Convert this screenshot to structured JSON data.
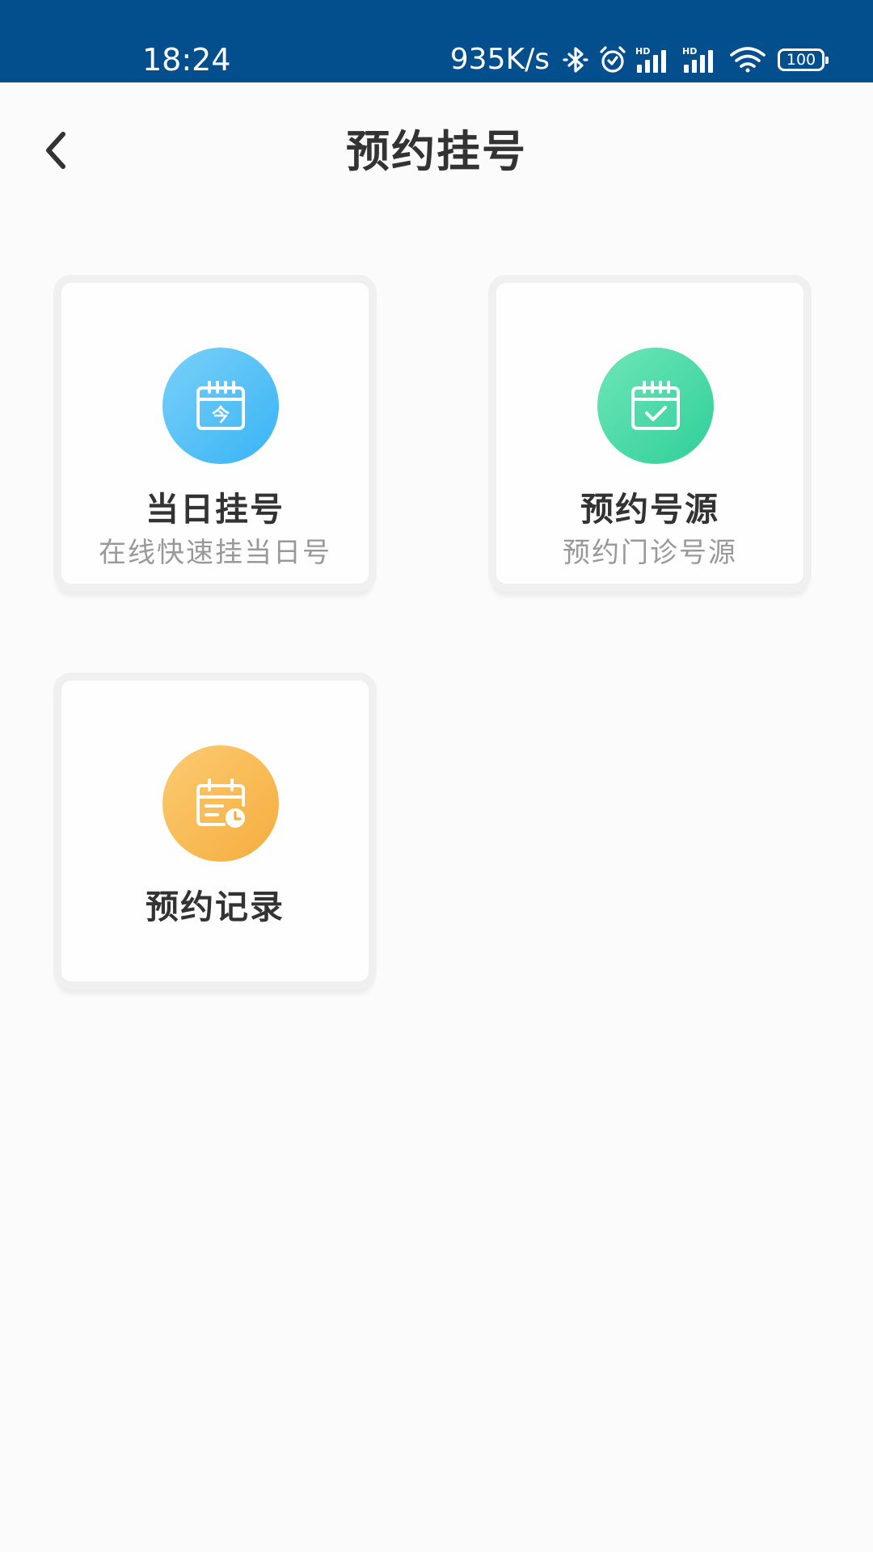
{
  "status_bar": {
    "time": "18:24",
    "net_speed": "935K/s",
    "battery": "100",
    "background": "#034f8e",
    "icons": [
      "bluetooth-icon",
      "alarm-icon",
      "hd-signal-icon",
      "hd-signal-icon",
      "wifi-icon",
      "battery-icon"
    ]
  },
  "header": {
    "title": "预约挂号",
    "back_icon": "chevron-left-icon"
  },
  "cards": [
    {
      "title": "当日挂号",
      "subtitle": "在线快速挂当日号",
      "icon": "calendar-today-icon",
      "icon_glyph": "今",
      "icon_color": "#38b4f5"
    },
    {
      "title": "预约号源",
      "subtitle": "预约门诊号源",
      "icon": "calendar-check-icon",
      "icon_color": "#2fcf9a"
    },
    {
      "title": "预约记录",
      "icon": "calendar-clock-icon",
      "icon_color": "#f5ad3e"
    }
  ],
  "colors": {
    "background": "#fbfbfb",
    "title_text": "#333333",
    "subtitle_text": "#999999"
  }
}
